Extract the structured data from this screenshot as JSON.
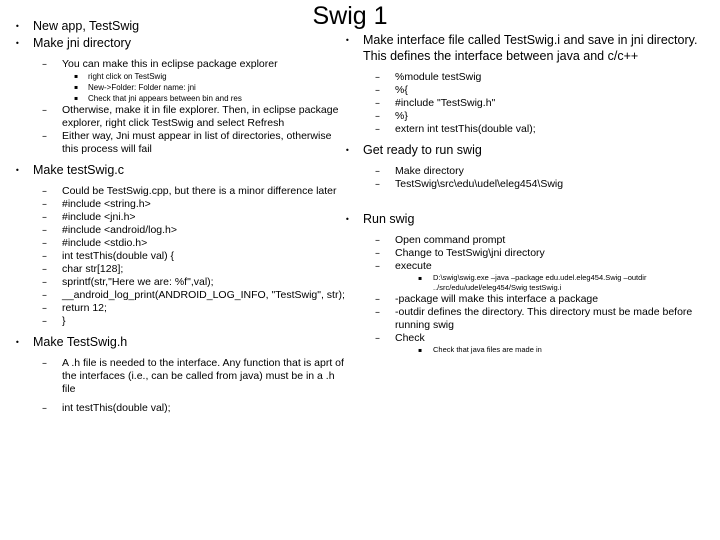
{
  "slide": {
    "title": "Swig 1",
    "bullet_glyphs": {
      "level1": "•",
      "level2": "–",
      "level3": "▪"
    },
    "left_column": [
      {
        "level": 1,
        "text": "New app, TestSwig"
      },
      {
        "level": 1,
        "text": "Make jni directory"
      },
      {
        "level": 2,
        "text": "You can make this in eclipse package explorer"
      },
      {
        "level": 3,
        "text": "right click on TestSwig"
      },
      {
        "level": 3,
        "text": "New->Folder: Folder name: jni"
      },
      {
        "level": 3,
        "text": "Check that jni appears between bin and res"
      },
      {
        "level": 2,
        "text": "Otherwise, make it in file explorer. Then, in eclipse package explorer, right click TestSwig and select Refresh"
      },
      {
        "level": 2,
        "text": "Either way, Jni must appear in list of directories, otherwise this process will fail"
      },
      {
        "level": 1,
        "text": "Make testSwig.c"
      },
      {
        "level": 2,
        "text": "Could be TestSwig.cpp, but there is a minor difference later"
      },
      {
        "level": 2,
        "text": "#include <string.h>"
      },
      {
        "level": 2,
        "text": "#include <jni.h>"
      },
      {
        "level": 2,
        "text": "#include <android/log.h>"
      },
      {
        "level": 2,
        "text": "#include <stdio.h>"
      },
      {
        "level": 2,
        "text": "int testThis(double val) {"
      },
      {
        "level": 2,
        "text": "    char str[128];"
      },
      {
        "level": 2,
        "text": "    sprintf(str,\"Here we are: %f\",val);"
      },
      {
        "level": 2,
        "text": "    __android_log_print(ANDROID_LOG_INFO, \"TestSwig\", str);"
      },
      {
        "level": 2,
        "text": "    return 12;"
      },
      {
        "level": 2,
        "text": "}"
      },
      {
        "level": 1,
        "text": "Make TestSwig.h"
      },
      {
        "level": 2,
        "text": "A .h file is needed to the interface. Any function that is aprt of the interfaces (i.e., can be called from java) must be in a .h file"
      },
      {
        "level": 2,
        "text": "int testThis(double val);"
      }
    ],
    "right_column": [
      {
        "level": 1,
        "text": "Make interface file called TestSwig.i and save in jni directory. This defines the interface between java and c/c++"
      },
      {
        "level": 2,
        "text": "%module testSwig"
      },
      {
        "level": 2,
        "text": "%{"
      },
      {
        "level": 2,
        "text": "#include \"TestSwig.h\""
      },
      {
        "level": 2,
        "text": "%}"
      },
      {
        "level": 2,
        "text": "extern int testThis(double val);"
      },
      {
        "level": 1,
        "text": "Get ready to run swig"
      },
      {
        "level": 2,
        "text": "Make directory"
      },
      {
        "level": 2,
        "text": "TestSwig\\src\\edu\\udel\\eleg454\\Swig"
      },
      {
        "level": 1,
        "text": "Run swig"
      },
      {
        "level": 2,
        "text": "Open command prompt"
      },
      {
        "level": 2,
        "text": "Change to TestSwig\\jni directory"
      },
      {
        "level": 2,
        "text": "execute"
      },
      {
        "level": 3,
        "text": "D:\\swig\\swig.exe –java –package edu.udel.eleg454.Swig –outdir ../src/edu/udel/eleg454/Swig testSwig.i"
      },
      {
        "level": 2,
        "text": "-package will make this interface a package"
      },
      {
        "level": 2,
        "text": "-outdir defines the directory. This directory must be made before running swig"
      },
      {
        "level": 2,
        "text": "Check"
      },
      {
        "level": 3,
        "text": "Check that java files are made in"
      }
    ]
  }
}
